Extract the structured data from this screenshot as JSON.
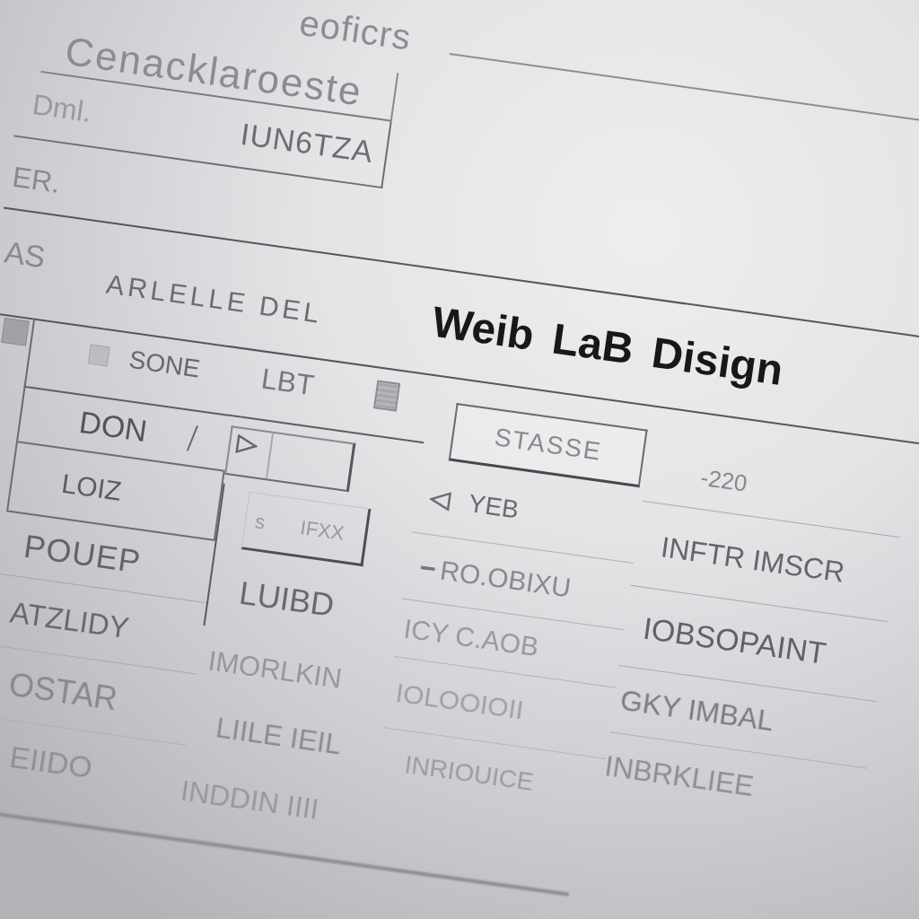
{
  "top_card": {
    "heading": "eoficrs",
    "title": "Cenacklaroeste",
    "label": "Dml.",
    "code": "IUN6TZA"
  },
  "side_note": "ER.",
  "header": {
    "side_text": "AS",
    "label": "ARLELLE DEL",
    "title": "Weib LaB Disign"
  },
  "form": {
    "columns": [
      {
        "items": [
          {
            "kind": "square_before",
            "text": "SONE"
          },
          {
            "kind": "text_divider",
            "text": "DON"
          },
          {
            "kind": "field",
            "value": "LOIZ"
          },
          {
            "kind": "text",
            "text": "POUEP"
          },
          {
            "kind": "text",
            "text": "ATZLIDY"
          },
          {
            "kind": "text",
            "text": "OSTAR"
          },
          {
            "kind": "text",
            "text": "EIIDO"
          }
        ]
      },
      {
        "items": [
          {
            "kind": "square_after",
            "text": "LBT"
          },
          {
            "kind": "select"
          },
          {
            "kind": "field",
            "value": "s IFXX"
          },
          {
            "kind": "text",
            "text": "LUIBD"
          },
          {
            "kind": "text",
            "text": "IMORLKIN"
          },
          {
            "kind": "text",
            "text": "LIILE IEIL"
          },
          {
            "kind": "text",
            "text": "INDDIN IIII"
          }
        ]
      },
      {
        "items": [
          {
            "kind": "button",
            "label": "STASSE"
          },
          {
            "kind": "pointer",
            "text": "YEB"
          },
          {
            "kind": "dash",
            "text": "RO.OBIXU"
          },
          {
            "kind": "text",
            "text": "ICY C.AOB"
          },
          {
            "kind": "text",
            "text": "IOLOOIOII"
          },
          {
            "kind": "text",
            "text": "INRIOUICE"
          }
        ]
      },
      {
        "items": [
          {
            "kind": "text",
            "text": "-220"
          },
          {
            "kind": "text",
            "text": "INFTR IMSCR"
          },
          {
            "kind": "text",
            "text": "IOBSOPAINT"
          },
          {
            "kind": "text",
            "text": "GKY IMBAL"
          },
          {
            "kind": "text",
            "text": "INBRKLIEE"
          }
        ]
      }
    ]
  }
}
